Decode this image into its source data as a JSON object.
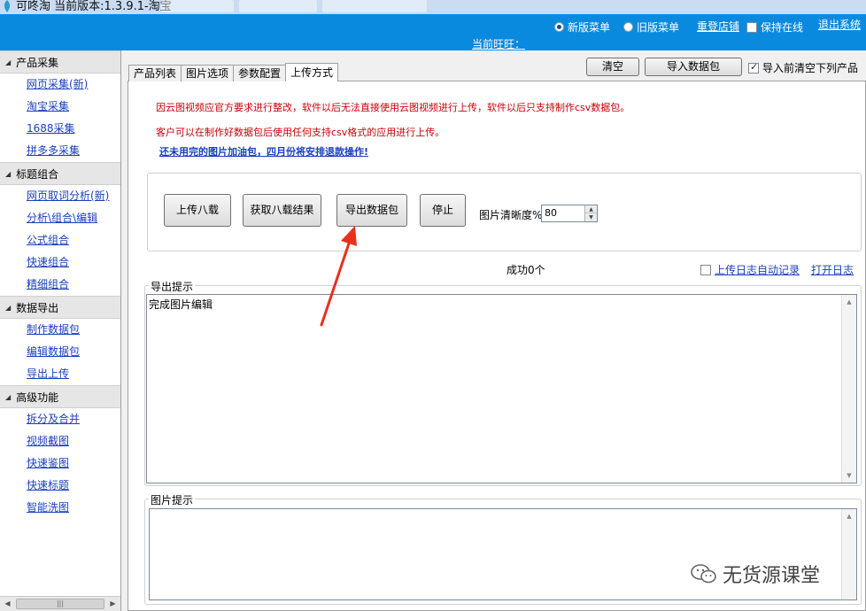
{
  "window": {
    "title": "可咚淘  当前版本:1.3.9.1-淘宝"
  },
  "header": {
    "new_menu": "新版菜单",
    "old_menu": "旧版菜单",
    "relogin": "重登店铺",
    "keep_online": "保持在线",
    "logout": "退出系统",
    "current_wangwang": "当前旺旺："
  },
  "sidebar": {
    "sections": [
      {
        "title": "产品采集",
        "items": [
          "网页采集(新)",
          "淘宝采集",
          "1688采集",
          "拼多多采集"
        ]
      },
      {
        "title": "标题组合",
        "items": [
          "网页取词分析(新)",
          "分析\\组合\\编辑",
          "公式组合",
          "快速组合",
          "精细组合"
        ]
      },
      {
        "title": "数据导出",
        "items": [
          "制作数据包",
          "编辑数据包",
          "导出上传"
        ]
      },
      {
        "title": "高级功能",
        "items": [
          "拆分及合并",
          "视频截图",
          "快速鉴图",
          "快速标题",
          "智能洗图"
        ]
      }
    ]
  },
  "tabs": [
    "产品列表",
    "图片选项",
    "参数配置",
    "上传方式"
  ],
  "toolbar": {
    "clear": "清空",
    "import": "导入数据包",
    "clear_before_import": "导入前清空下列产品"
  },
  "notices": {
    "line1": "因云图视频应官方要求进行整改，软件以后无法直接使用云图视频进行上传，软件以后只支持制作csv数据包。",
    "line2": "客户可以在制作好数据包后使用任何支持csv格式的应用进行上传。",
    "link": "还未用完的图片加油包，四月份将安排退款操作!"
  },
  "actions": {
    "upload": "上传八载",
    "get_result": "获取八载结果",
    "export": "导出数据包",
    "stop": "停止"
  },
  "quality": {
    "label": "图片清晰度%",
    "value": "80"
  },
  "status": {
    "success": "成功0个",
    "auto_log": "上传日志自动记录",
    "open_log": "打开日志"
  },
  "export_panel": {
    "legend": "导出提示",
    "content": "完成图片编辑"
  },
  "image_panel": {
    "legend": "图片提示",
    "content": ""
  },
  "watermark": {
    "text": "无货源课堂"
  },
  "colors": {
    "header_bg": "#0a8ade",
    "link": "#1a3fbf",
    "notice_red": "#c8000a",
    "arrow": "#e8301e"
  }
}
